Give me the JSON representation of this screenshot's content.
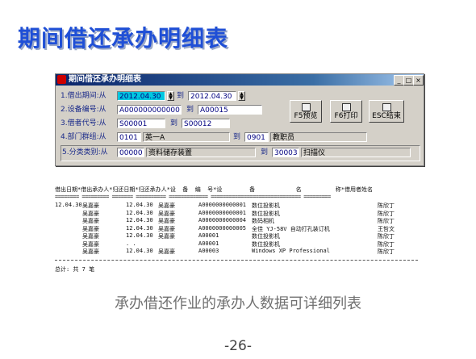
{
  "slide": {
    "title": "期间借还承办明细表",
    "caption": "承办借还作业的承办人数据可详细列表",
    "page_number": "-26-"
  },
  "window": {
    "title": "期间借还承办明细表",
    "buttons": {
      "minimize": "_",
      "maximize": "□",
      "close": "×"
    }
  },
  "form": {
    "borrow_date": {
      "label": "1.借出期间:从",
      "from": "2012.04.30",
      "to_label": "到",
      "to": "2012.04.30"
    },
    "device_no": {
      "label": "2.设备编号:从",
      "from": "A0000000000001",
      "to_label": "到",
      "to": "A00015"
    },
    "borrower_code": {
      "label": "3.借者代号:从",
      "from": "S00001",
      "to_label": "到",
      "to": "S00012"
    },
    "department": {
      "label": "4.部门群组:从",
      "from_code": "0101",
      "from_name": "英一A",
      "to_label": "到",
      "to_code": "0901",
      "to_name": "教职员"
    },
    "category": {
      "label": "5.分类类别:从",
      "from_code": "00000",
      "from_name": "资料储存装置",
      "to_label": "到",
      "to_code": "30003",
      "to_name": "扫描仪"
    }
  },
  "actions": {
    "preview": "F5预览",
    "print": "F6打印",
    "exit": "ESC结束"
  },
  "report": {
    "header": "借出日期*借出承办人*归还日期*归还承办人*设  备  编  号*设        备            名          称*借用者姓名",
    "separator": "======== ========= ======= ========== ============= ============================== =========",
    "rows": [
      {
        "date": "12.04.30",
        "lender": "吴嘉豪",
        "return_date": "12.04.30",
        "returner": "吴嘉豪",
        "device_no": "A0000000000001",
        "device_name": "数位投影机",
        "borrower": "陈欣丁"
      },
      {
        "date": "",
        "lender": "吴嘉豪",
        "return_date": "12.04.30",
        "returner": "吴嘉豪",
        "device_no": "A0000000000001",
        "device_name": "数位投影机",
        "borrower": "陈欣丁"
      },
      {
        "date": "",
        "lender": "吴嘉豪",
        "return_date": "12.04.30",
        "returner": "吴嘉豪",
        "device_no": "A0000000000004",
        "device_name": "数码相机",
        "borrower": "陈欣丁"
      },
      {
        "date": "",
        "lender": "吴嘉豪",
        "return_date": "12.04.30",
        "returner": "吴嘉豪",
        "device_no": "A0000000000005",
        "device_name": "全佳 YJ-58V 自动打孔装订机",
        "borrower": "王哲文"
      },
      {
        "date": "",
        "lender": "吴嘉豪",
        "return_date": "12.04.30",
        "returner": "吴嘉豪",
        "device_no": "A00001",
        "device_name": "数位投影机",
        "borrower": "陈欣丁"
      },
      {
        "date": "",
        "lender": "吴嘉豪",
        "return_date": "  .  .",
        "returner": "",
        "device_no": "A00001",
        "device_name": "数位投影机",
        "borrower": "陈欣丁"
      },
      {
        "date": "",
        "lender": "吴嘉豪",
        "return_date": "12.04.30",
        "returner": "吴嘉豪",
        "device_no": "A00003",
        "device_name": "Windows XP Professional",
        "borrower": "陈欣丁"
      }
    ],
    "total": "总计: 共 7 笔"
  }
}
